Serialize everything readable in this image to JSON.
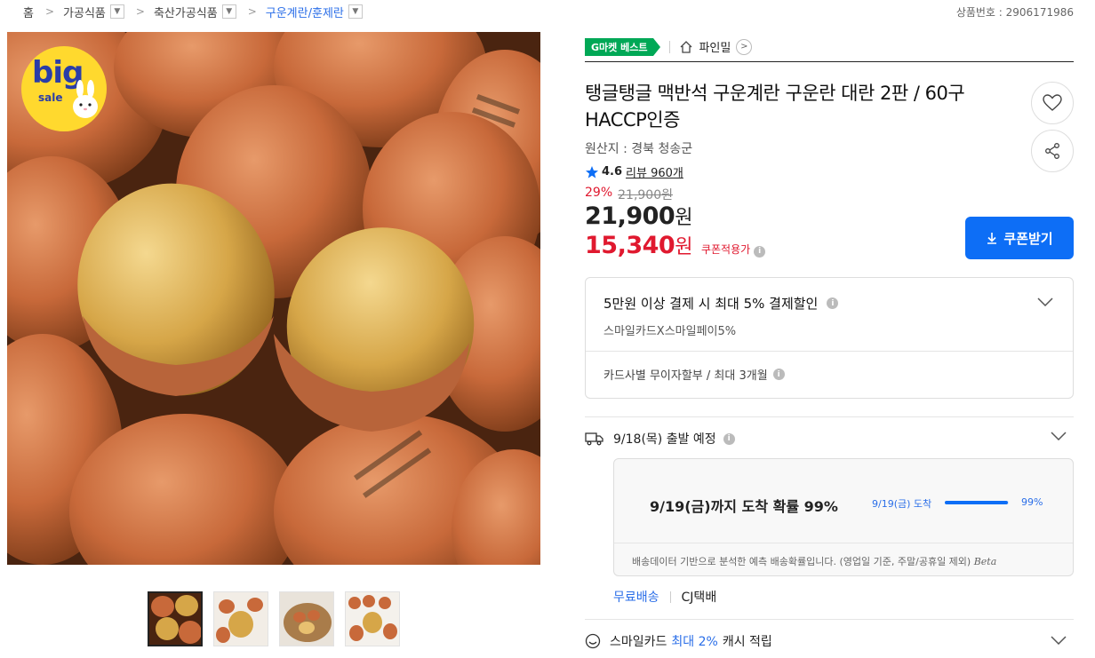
{
  "breadcrumb": {
    "home": "홈",
    "level1": "가공식품",
    "level2": "축산가공식품",
    "level3": "구운계란/훈제란"
  },
  "product_no": "상품번호 : 2906171986",
  "main_image": {
    "badge_big": "big",
    "badge_sale": "sale"
  },
  "seller": {
    "badge": "G마켓 베스트",
    "name": "파인밀"
  },
  "product": {
    "title": "탱글탱글 맥반석 구운계란 구운란 대란 2판 / 60구 HACCP인증",
    "origin": "원산지 : 경북 청송군",
    "rating": "4.6",
    "review": "리뷰 960개",
    "discount_rate": "29%",
    "original_price": "21,900원",
    "price_num": "21,900",
    "price_unit": "원",
    "coupon_price_num": "15,340",
    "coupon_price_unit": "원",
    "coupon_label": "쿠폰적용가",
    "coupon_button": "쿠폰받기"
  },
  "card_offer": {
    "title": "5만원 이상 결제 시 최대 5% 결제할인",
    "sub": "스마일카드X스마일페이5%",
    "installment": "카드사별 무이자할부 / 최대 3개월"
  },
  "shipping": {
    "departure": "9/18(목) 출발 예정",
    "arrival_main": "9/19(금)까지 도착 확률 99%",
    "arrival_date": "9/19(금) 도착",
    "arrival_pct": "99%",
    "arrival_value": 0.99,
    "note": "배송데이터 기반으로 분석한 예측 배송확률입니다. (영업일 기준, 주말/공휴일 제외)",
    "beta": "Beta",
    "free": "무료배송",
    "courier": "CJ택배"
  },
  "smile": {
    "prefix": "스마일카드",
    "highlight": "최대 2%",
    "suffix": "캐시 적립"
  },
  "colors": {
    "accent": "#0d6ef6",
    "sale_red": "#e0192f",
    "gmarket_green": "#00a856"
  }
}
